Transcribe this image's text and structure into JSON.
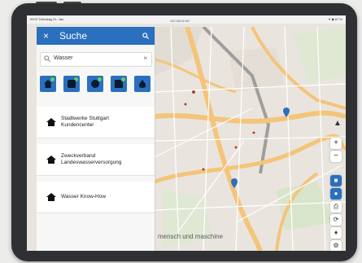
{
  "statusbar": {
    "time": "09:07  Dienstag 21. Jan.",
    "url": "192.168.24.167",
    "indicators": "✦ ◆ 67 %"
  },
  "sidebar": {
    "title": "Suche",
    "search_value": "Wasser",
    "items": [
      {
        "line1": "Stadtwerke Stuttgart",
        "line2": "Kundencenter"
      },
      {
        "line1": "Zweckverband",
        "line2": "Landeswasserversorgung"
      },
      {
        "line1": "Wasser Know-How",
        "line2": ""
      }
    ]
  },
  "map": {
    "brand": "mensch und maschine"
  },
  "icons": {
    "close": "close-icon",
    "search": "search-icon",
    "clear": "clear-icon",
    "home": "home-icon",
    "compass": "compass-icon",
    "zoom_in": "zoom-in-icon",
    "zoom_out": "zoom-out-icon",
    "print": "print-icon",
    "settings": "settings-icon",
    "location": "location-pin-icon"
  },
  "colors": {
    "accent": "#2b6fbf",
    "map_bg": "#e9e5de",
    "road": "#f4c47a"
  }
}
